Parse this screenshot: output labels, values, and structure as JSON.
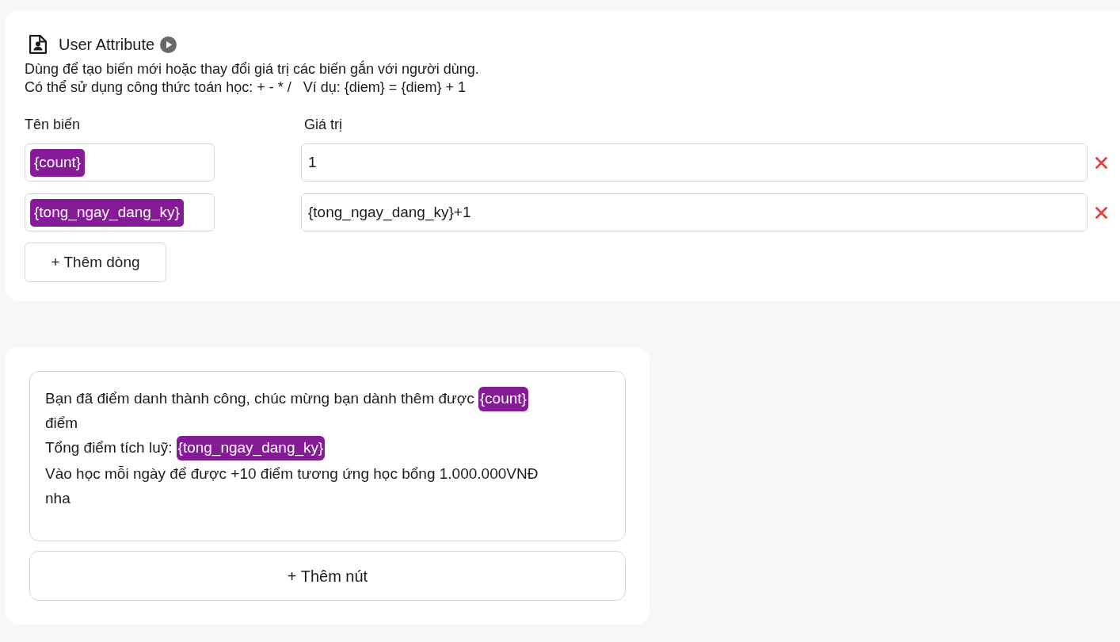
{
  "user_attribute": {
    "title": "User Attribute",
    "description": [
      "Dùng để tạo biến mới hoặc thay đổi giá trị các biến gắn với người dùng.",
      "Có thể sử dụng công thức toán học: + - * /   Ví dụ: {diem} = {diem} + 1"
    ],
    "columns": [
      "Tên biến",
      "Giá trị"
    ],
    "rows": [
      {
        "variable": "{count}",
        "value": "1"
      },
      {
        "variable": "{tong_ngay_dang_ky}",
        "value": "{tong_ngay_dang_ky}+1"
      }
    ],
    "add_row_button": "+ Thêm dòng"
  },
  "message": {
    "lines": [
      [
        {
          "kind": "text",
          "text": "Bạn đã điểm danh thành công, chúc mừng bạn dành thêm được"
        },
        {
          "kind": "variable",
          "text": "{count}"
        }
      ],
      [
        {
          "kind": "text",
          "text": "điểm"
        }
      ],
      [
        {
          "kind": "text",
          "text": "Tổng điểm tích luỹ:"
        },
        {
          "kind": "variable",
          "text": "{tong_ngay_dang_ky}"
        }
      ],
      [
        {
          "kind": "text",
          "text": "Vào học mỗi ngày để được +10 điểm tương ứng học bổng 1.000.000VNĐ"
        }
      ],
      [
        {
          "kind": "text",
          "text": "nha"
        }
      ]
    ],
    "add_button": "+ Thêm nút"
  }
}
